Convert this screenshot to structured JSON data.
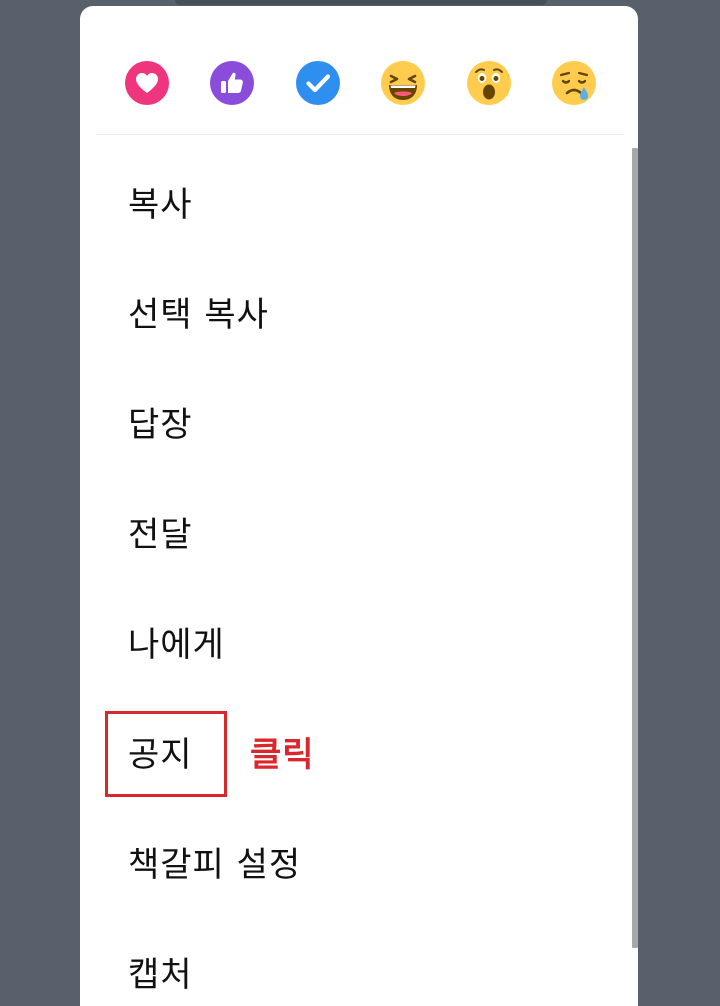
{
  "reactions": [
    {
      "name": "heart",
      "color": "#f0357f"
    },
    {
      "name": "thumbs-up",
      "color": "#8a4cdb"
    },
    {
      "name": "check",
      "color": "#2f8ff0"
    },
    {
      "name": "laughing-face",
      "color": "#ffcc4d"
    },
    {
      "name": "surprised-face",
      "color": "#ffcc4d"
    },
    {
      "name": "crying-face",
      "color": "#ffcc4d"
    }
  ],
  "menu": {
    "items": [
      {
        "id": "copy",
        "label": "복사"
      },
      {
        "id": "select-copy",
        "label": "선택 복사"
      },
      {
        "id": "reply",
        "label": "답장"
      },
      {
        "id": "forward",
        "label": "전달"
      },
      {
        "id": "to-me",
        "label": "나에게"
      },
      {
        "id": "notice",
        "label": "공지"
      },
      {
        "id": "bookmark-settings",
        "label": "책갈피 설정"
      },
      {
        "id": "capture",
        "label": "캡처"
      }
    ]
  },
  "annotation": {
    "label": "클릭",
    "color": "#d8282d",
    "target": "notice"
  }
}
